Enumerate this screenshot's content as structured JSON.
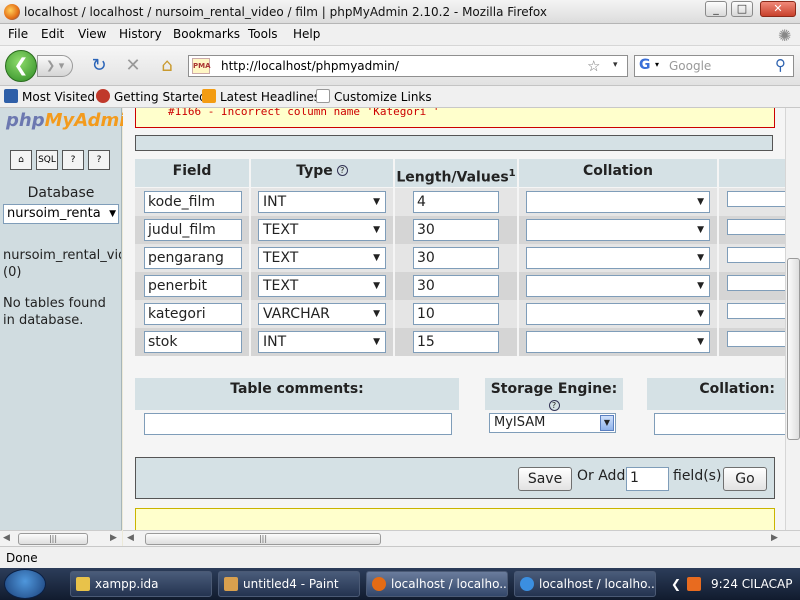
{
  "window": {
    "title": "localhost / localhost / nursoim_rental_video / film | phpMyAdmin 2.10.2 - Mozilla Firefox",
    "minimize": "_",
    "maximize": "□",
    "close": "✕"
  },
  "menu": [
    "File",
    "Edit",
    "View",
    "History",
    "Bookmarks",
    "Tools",
    "Help"
  ],
  "nav": {
    "url": "http://localhost/phpmyadmin/",
    "favicon_text": "PMA",
    "search_placeholder": "Google",
    "search_engine": "G"
  },
  "bookmarks": [
    "Most Visited",
    "Getting Started",
    "Latest Headlines",
    "Customize Links"
  ],
  "sidebar": {
    "logo_php": "php",
    "logo_myadmin": "MyAdmin",
    "buttons": [
      "home-icon",
      "sql-icon",
      "query-window-icon",
      "docs-icon"
    ],
    "database_label": "Database",
    "database_select": "nursoim_renta",
    "db_name": "nursoim_rental_vide",
    "db_count": "(0)",
    "no_tables": "No tables found in database."
  },
  "error": {
    "message": "#1166 - Incorrect column name 'Kategori '"
  },
  "fields_table": {
    "headers": {
      "field": "Field",
      "type": "Type",
      "length": "Length/Values",
      "length_sup": "1",
      "collation": "Collation"
    },
    "rows": [
      {
        "field": "kode_film",
        "type": "INT",
        "length": "4",
        "collation": ""
      },
      {
        "field": "judul_film",
        "type": "TEXT",
        "length": "30",
        "collation": ""
      },
      {
        "field": "pengarang",
        "type": "TEXT",
        "length": "30",
        "collation": ""
      },
      {
        "field": "penerbit",
        "type": "TEXT",
        "length": "30",
        "collation": ""
      },
      {
        "field": "kategori",
        "type": "VARCHAR",
        "length": "10",
        "collation": ""
      },
      {
        "field": "stok",
        "type": "INT",
        "length": "15",
        "collation": ""
      }
    ]
  },
  "table_options": {
    "comments_label": "Table comments:",
    "comments_value": "",
    "engine_label": "Storage Engine:",
    "engine_value": "MyISAM",
    "collation_label": "Collation:",
    "collation_value": ""
  },
  "actions": {
    "save": "Save",
    "or_add": "Or Add",
    "add_count": "1",
    "fields": "field(s)",
    "go": "Go"
  },
  "status": "Done",
  "taskbar": {
    "tasks": [
      {
        "label": "xampp.ida",
        "active": false
      },
      {
        "label": "untitled4 - Paint",
        "active": false
      },
      {
        "label": "localhost / localho...",
        "active": true
      },
      {
        "label": "localhost / localho...",
        "active": false
      }
    ],
    "tray_arrow": "❮",
    "clock": "9:24 CILACAP"
  },
  "colors": {
    "header_bg": "#d5e1e5",
    "row_odd": "#e5e5e5",
    "row_even": "#d5d5d5",
    "error_text": "#cc0000",
    "error_bg": "#ffffcc"
  }
}
